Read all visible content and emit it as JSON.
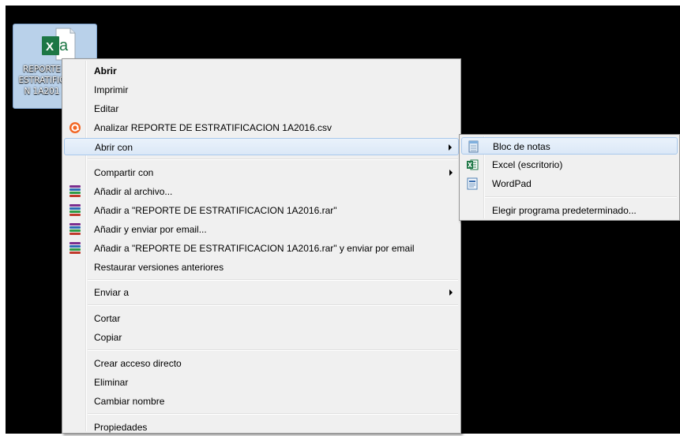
{
  "desktop": {
    "file_icon": {
      "badge": "X",
      "name_lines": [
        "REPORTE",
        "ESTRATIFIC",
        "N 1A201"
      ]
    }
  },
  "context_menu": {
    "items": [
      {
        "label": "Abrir",
        "bold": true
      },
      {
        "label": "Imprimir"
      },
      {
        "label": "Editar"
      },
      {
        "label": "Analizar REPORTE DE ESTRATIFICACION 1A2016.csv",
        "icon": "avast-icon"
      },
      {
        "label": "Abrir con",
        "submenu": true,
        "highlighted": true
      },
      {
        "label": "Compartir con",
        "submenu": true
      },
      {
        "label": "Añadir al archivo...",
        "icon": "winrar-icon"
      },
      {
        "label": "Añadir a \"REPORTE DE ESTRATIFICACION 1A2016.rar\"",
        "icon": "winrar-icon"
      },
      {
        "label": "Añadir y enviar por email...",
        "icon": "winrar-icon"
      },
      {
        "label": "Añadir a \"REPORTE DE ESTRATIFICACION 1A2016.rar\" y enviar por email",
        "icon": "winrar-icon"
      },
      {
        "label": "Restaurar versiones anteriores"
      },
      {
        "label": "Enviar a",
        "submenu": true
      },
      {
        "label": "Cortar"
      },
      {
        "label": "Copiar"
      },
      {
        "label": "Crear acceso directo"
      },
      {
        "label": "Eliminar"
      },
      {
        "label": "Cambiar nombre"
      },
      {
        "label": "Propiedades"
      }
    ]
  },
  "open_with_submenu": {
    "items": [
      {
        "label": "Bloc de notas",
        "icon": "notepad-icon",
        "highlighted": true
      },
      {
        "label": "Excel (escritorio)",
        "icon": "excel-icon"
      },
      {
        "label": "WordPad",
        "icon": "wordpad-icon"
      },
      {
        "label": "Elegir programa predeterminado..."
      }
    ]
  },
  "colors": {
    "desktop_bg": "#000000",
    "menu_bg": "#f0f0f0",
    "highlight_bg": "#dbe8f7",
    "highlight_border": "#a8c8ec",
    "excel_green": "#1d7745",
    "avast_orange": "#f26522"
  }
}
